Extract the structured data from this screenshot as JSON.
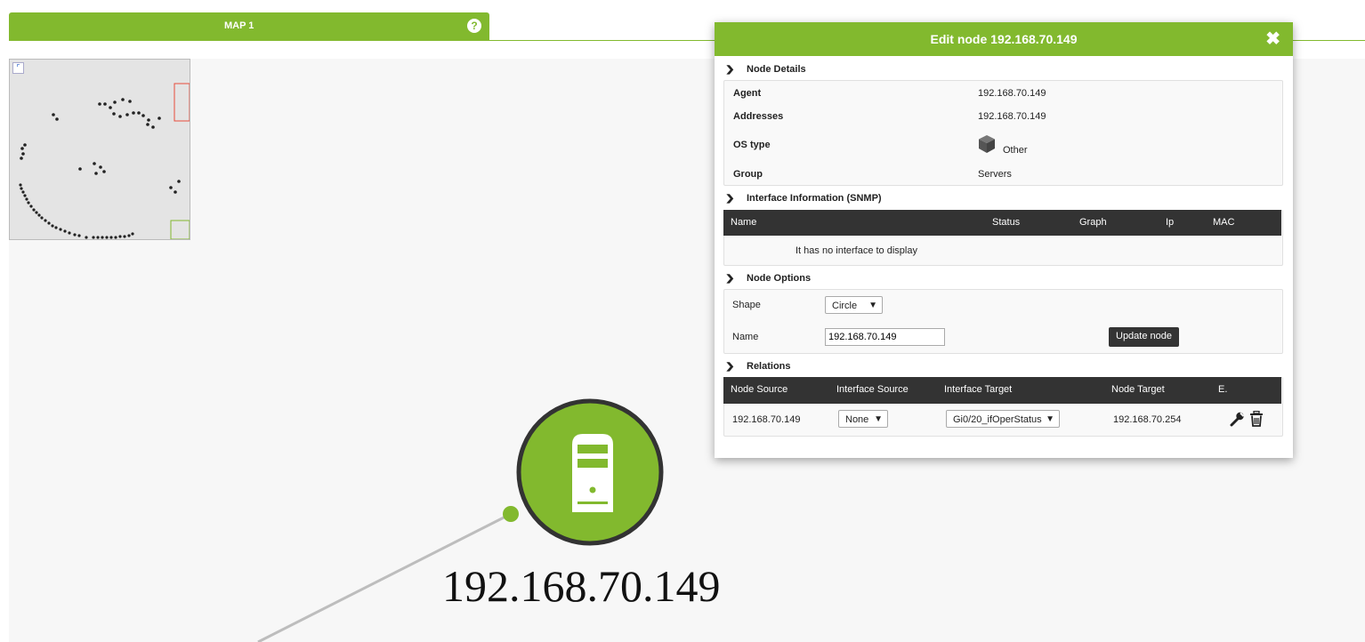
{
  "tab": {
    "title": "MAP 1",
    "help_label": "?"
  },
  "map": {
    "node_label": "192.168.70.149",
    "node_color": "#82b92e",
    "node_icon": "server-icon"
  },
  "minimap": {
    "corner_icon": "expand-icon"
  },
  "dialog": {
    "title": "Edit node 192.168.70.149",
    "close_label": "✖",
    "node_details": {
      "heading": "Node Details",
      "agent_label": "Agent",
      "agent_value": "192.168.70.149",
      "addresses_label": "Addresses",
      "addresses_value": "192.168.70.149",
      "ostype_label": "OS type",
      "ostype_value": "Other",
      "ostype_icon": "cube-icon",
      "group_label": "Group",
      "group_value": "Servers"
    },
    "interfaces": {
      "heading": "Interface Information (SNMP)",
      "columns": [
        "Name",
        "Status",
        "Graph",
        "Ip",
        "MAC"
      ],
      "empty_text": "It has no interface to display"
    },
    "node_options": {
      "heading": "Node Options",
      "shape_label": "Shape",
      "shape_value": "Circle",
      "name_label": "Name",
      "name_value": "192.168.70.149",
      "update_label": "Update node"
    },
    "relations": {
      "heading": "Relations",
      "columns": [
        "Node Source",
        "Interface Source",
        "Interface Target",
        "Node Target",
        "E."
      ],
      "row": {
        "node_source": "192.168.70.149",
        "interface_source": "None",
        "interface_target": "Gi0/20_ifOperStatus",
        "node_target": "192.168.70.254"
      }
    }
  },
  "colors": {
    "accent": "#82b92e",
    "dark_header": "#333333"
  }
}
